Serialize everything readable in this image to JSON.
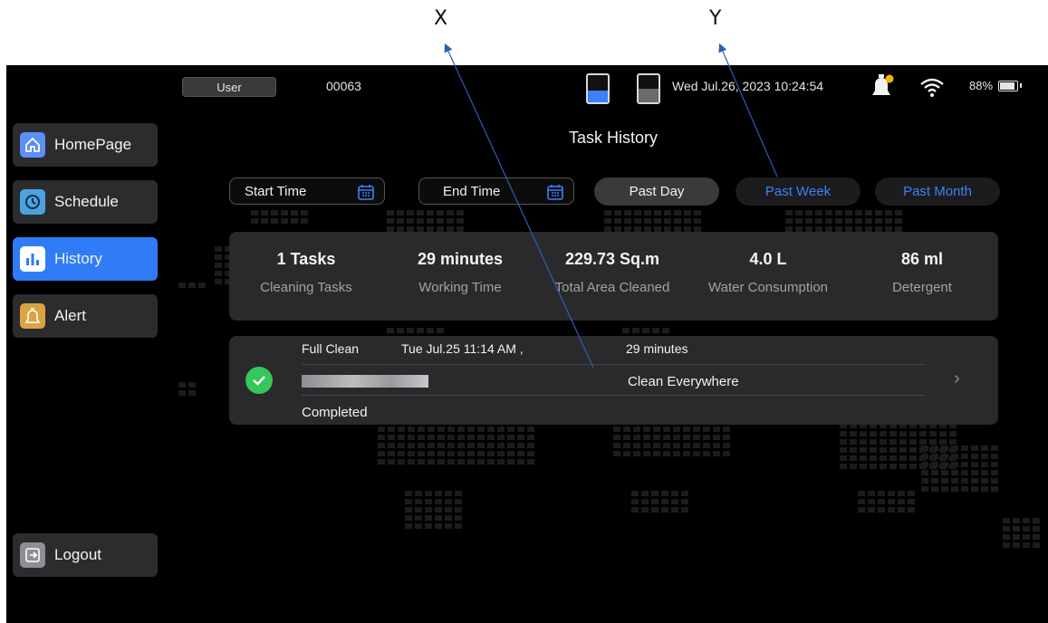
{
  "annotations": {
    "x_label": "X",
    "y_label": "Y"
  },
  "status_bar": {
    "user_button": "User",
    "user_id": "00063",
    "clean_tank_level": 0.45,
    "dirty_tank_level": 0.5,
    "datetime": "Wed Jul.26, 2023 10:24:54",
    "battery": "88%",
    "battery_level": 0.88
  },
  "sidebar": {
    "items": [
      {
        "label": "HomePage",
        "icon": "home-icon"
      },
      {
        "label": "Schedule",
        "icon": "clock-icon"
      },
      {
        "label": "History",
        "icon": "bar-chart-icon",
        "active": true
      },
      {
        "label": "Alert",
        "icon": "alarm-icon"
      }
    ],
    "logout": {
      "label": "Logout",
      "icon": "logout-icon"
    }
  },
  "page": {
    "title": "Task History"
  },
  "filters": {
    "start_time": "Start Time",
    "end_time": "End Time",
    "past_day": "Past Day",
    "past_week": "Past Week",
    "past_month": "Past Month"
  },
  "stats": [
    {
      "value": "1 Tasks",
      "label": "Cleaning Tasks"
    },
    {
      "value": "29 minutes",
      "label": "Working Time"
    },
    {
      "value": "229.73 Sq.m",
      "label": "Total Area Cleaned"
    },
    {
      "value": "4.0 L",
      "label": "Water Consumption"
    },
    {
      "value": "86 ml",
      "label": "Detergent"
    }
  ],
  "task": {
    "mode": "Full Clean",
    "date": "Tue Jul.25 11:14 AM ,",
    "duration": "29 minutes",
    "area": "Clean Everywhere",
    "status": "Completed"
  },
  "colors": {
    "accent": "#2f7cf6",
    "link": "#3b82f6",
    "success": "#34c759",
    "card": "#2a2a2c",
    "background": "#000000"
  }
}
